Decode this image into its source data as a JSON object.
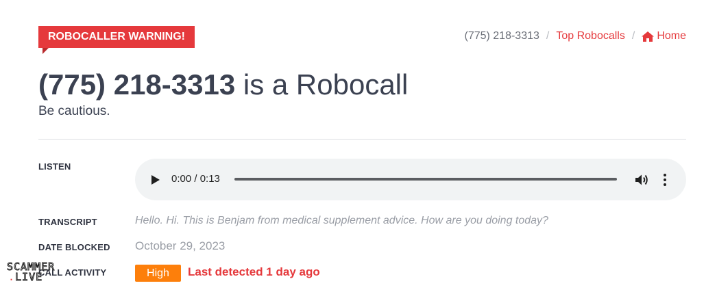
{
  "ribbon": {
    "label": "ROBOCALLER WARNING!"
  },
  "breadcrumb": {
    "current": "(775) 218-3313",
    "separator": "/",
    "top_robocalls": "Top Robocalls",
    "home": "Home",
    "home_icon": "home-icon"
  },
  "header": {
    "number": "(775) 218-3313",
    "suffix": " is a Robocall",
    "subtitle": "Be cautious."
  },
  "details": {
    "listen_label": "LISTEN",
    "audio": {
      "time": "0:00 / 0:13",
      "icons": [
        "play-icon",
        "volume-icon",
        "more-icon"
      ]
    },
    "transcript_label": "TRANSCRIPT",
    "transcript": "Hello. Hi. This is Benjam from medical supplement advice. How are you doing today?",
    "date_label": "DATE BLOCKED",
    "date": "October 29, 2023",
    "activity_label": "CALL ACTIVITY",
    "activity_level": "High",
    "last_detected": "Last detected 1 day ago"
  },
  "watermark": {
    "line1": "SCAMMER",
    "line2": "LIVE"
  },
  "colors": {
    "accent": "#e5393c",
    "badge": "#fd7f0b",
    "text": "#3b4151",
    "muted": "#9a9ea6"
  }
}
